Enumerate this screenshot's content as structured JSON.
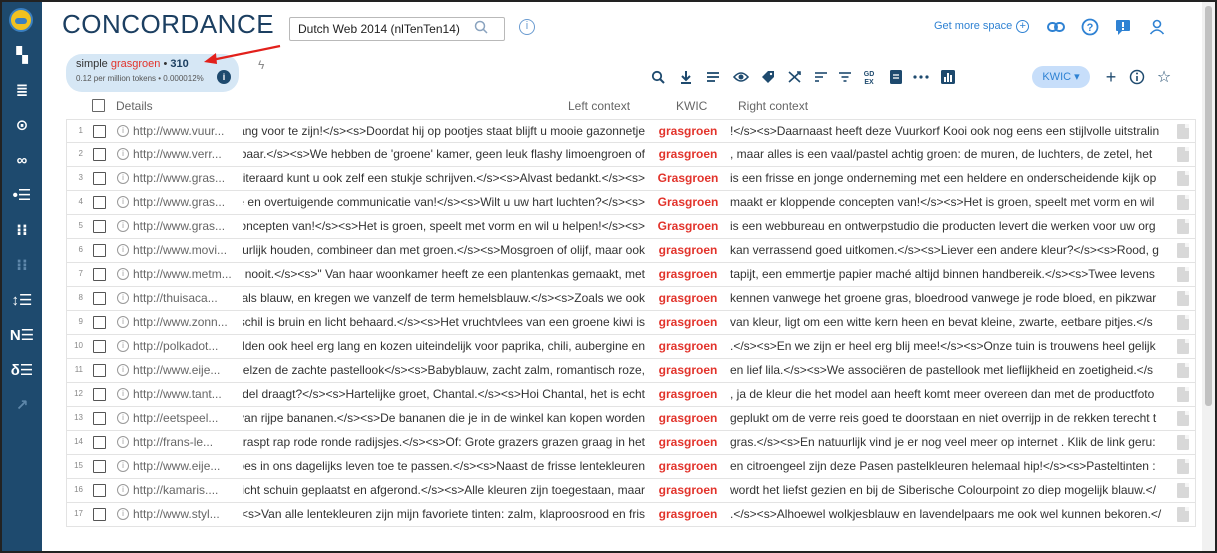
{
  "app": {
    "title": "CONCORDANCE",
    "corpus_value": "Dutch Web 2014 (nlTenTen14)",
    "get_more_space": "Get more space"
  },
  "sidebar": {
    "items": [
      {
        "name": "dashboard-icon",
        "glyph": "▚"
      },
      {
        "name": "list-icon",
        "glyph": "≣"
      },
      {
        "name": "circle-icon",
        "glyph": "⊙"
      },
      {
        "name": "chain-icon",
        "glyph": "∞"
      },
      {
        "name": "bullets-icon",
        "glyph": "•☰"
      },
      {
        "name": "columns-icon",
        "glyph": "⁝⁝"
      },
      {
        "name": "columns-dim-icon",
        "glyph": "⁝⁝"
      },
      {
        "name": "sort-icon",
        "glyph": "↕☰"
      },
      {
        "name": "ne-icon",
        "glyph": "N☰"
      },
      {
        "name": "delta-icon",
        "glyph": "δ☰"
      },
      {
        "name": "trend-icon",
        "glyph": "↗"
      }
    ]
  },
  "summary": {
    "prefix": "simple ",
    "query": "grasgroen",
    "sep": " • ",
    "count": "310",
    "stats": "0.12 per million tokens • 0.000012%"
  },
  "toolbar": {
    "view_mode": "KWIC ▾"
  },
  "table": {
    "headers": {
      "details": "Details",
      "left": "Left context",
      "kwic": "KWIC",
      "right": "Right context"
    },
    "rows": [
      {
        "num": "1",
        "url": "http://www.vuur...",
        "left": "t bang voor te zijn!</s><s>Doordat hij op pootjes staat blijft u mooie gazonnetje",
        "kwic": "grasgroen",
        "right": "!</s><s>Daarnaast heeft deze Vuurkorf Kooi ook nog eens een stijlvolle uitstralin"
      },
      {
        "num": "2",
        "url": "http://www.verr...",
        "left": "oosbaar.</s><s>We hebben de 'groene' kamer, geen leuk flashy limoengroen of",
        "kwic": "grasgroen",
        "right": ", maar alles is een vaal/pastel achtig groen: de muren, de luchters, de zetel, het"
      },
      {
        "num": "3",
        "url": "http://www.gras...",
        "left": "s>Uiteraard kunt u ook zelf een stukje schrijven.</s><s>Alvast bedankt.</s><s>",
        "kwic": "Grasgroen",
        "right": "is een frisse en jonge onderneming met een heldere en onderscheidende kijk op"
      },
      {
        "num": "4",
        "url": "http://www.gras...",
        "left": "isse en overtuigende communicatie van!</s><s>Wilt u uw hart luchten?</s><s>",
        "kwic": "Grasgroen",
        "right": "maakt er kloppende concepten van!</s><s>Het is groen, speelt met vorm en wil"
      },
      {
        "num": "5",
        "url": "http://www.gras...",
        "left": "e concepten van!</s><s>Het is groen, speelt met vorm en wil u helpen!</s><s>",
        "kwic": "Grasgroen",
        "right": "is een webbureau en ontwerpstudio die producten levert die werken voor uw org"
      },
      {
        "num": "6",
        "url": "http://www.movi...",
        "left": "natuurlijk houden, combineer dan met groen.</s><s>Mosgroen of olijf, maar ook",
        "kwic": "grasgroen",
        "right": "kan verrassend goed uitkomen.</s><s>Liever een andere kleur?</s><s>Rood, g"
      },
      {
        "num": "7",
        "url": "http://www.metm...",
        "left": "me nooit.</s><s>\" Van haar woonkamer heeft ze een plantenkas gemaakt, met",
        "kwic": "grasgroen",
        "right": "tapijt, een emmertje papier maché altijd binnen handbereik.</s><s>Twee levens"
      },
      {
        "num": "8",
        "url": "http://thuisaca...",
        "left": "lus als blauw, en kregen we vanzelf de term hemelsblauw.</s><s>Zoals we ook",
        "kwic": "grasgroen",
        "right": "kennen vanwege het groene gras, bloedrood vanwege je rode bloed, en pikzwar"
      },
      {
        "num": "9",
        "url": "http://www.zonn...",
        "left": "De schil is bruin en licht behaard.</s><s>Het vruchtvlees van een groene kiwi is",
        "kwic": "grasgroen",
        "right": "van kleur, ligt om een witte kern heen en bevat kleine, zwarte, eetbare pitjes.</s"
      },
      {
        "num": "10",
        "url": "http://polkadot...",
        "left": "vijfelden ook heel erg lang en kozen uiteindelijk voor paprika, chili, aubergine en",
        "kwic": "grasgroen",
        "right": ".</s><s>En we zijn er heel erg blij mee!</s><s>Onze tuin is trouwens heel gelijk"
      },
      {
        "num": "11",
        "url": "http://www.eije...",
        "left": "omhelzen de zachte pastellook</s><s>Babyblauw, zacht zalm, romantisch roze,",
        "kwic": "grasgroen",
        "right": "en lief lila.</s><s>We associëren de pastellook met lieflijkheid en zoetigheid.</s"
      },
      {
        "num": "12",
        "url": "http://www.tant...",
        "left": "model draagt?</s><s>Hartelijke groet, Chantal.</s><s>Hoi Chantal, het is echt",
        "kwic": "grasgroen",
        "right": ", ja de kleur die het model aan heeft komt meer overeen dan met de productfoto"
      },
      {
        "num": "13",
        "url": "http://eetspeel...",
        "left": "ur van rijpe bananen.</s><s>De bananen die je in de winkel kan kopen worden",
        "kwic": "grasgroen",
        "right": "geplukt om de verre reis goed te doorstaan en niet overrijp in de rekken terecht t"
      },
      {
        "num": "14",
        "url": "http://frans-le...",
        "left": "ups raspt rap rode ronde radijsjes.</s><s>Of: Grote grazers grazen graag in het",
        "kwic": "grasgroen",
        "right": "gras.</s><s>En natuurlijk vind je er nog veel meer op internet . Klik de link geru:"
      },
      {
        "num": "15",
        "url": "http://www.eije...",
        "left": "ncipes in ons dagelijks leven toe te passen.</s><s>Naast de frisse lentekleuren",
        "kwic": "grasgroen",
        "right": "en citroengeel zijn deze Pasen pastelkleuren helemaal hip!</s><s>Pasteltinten :"
      },
      {
        "num": "16",
        "url": "http://kamaris....",
        "left": "n, licht schuin geplaatst en afgerond.</s><s>Alle kleuren zijn toegestaan, maar",
        "kwic": "grasgroen",
        "right": "wordt het liefst gezien en bij de Siberische Colourpoint zo diep mogelijk blauw.</"
      },
      {
        "num": "17",
        "url": "http://www.styl...",
        "left": "/s><s>Van alle lentekleuren zijn mijn favoriete tinten: zalm, klaproosrood en fris",
        "kwic": "grasgroen",
        "right": ".</s><s>Alhoewel wolkjesblauw en lavendelpaars me ook wel kunnen bekoren.</"
      }
    ]
  },
  "colors": {
    "sidebar": "#1e4a6e",
    "accent": "#2f82d3",
    "keyword": "#e2332b",
    "summary_bg": "#d6e7f5"
  }
}
